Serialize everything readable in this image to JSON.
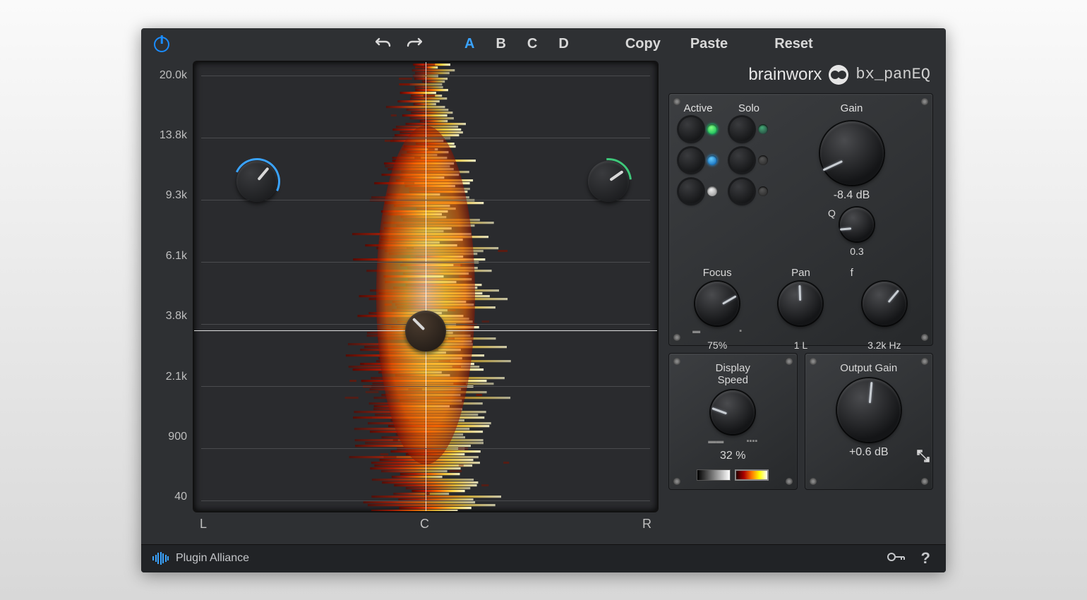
{
  "toolbar": {
    "snapshots": [
      "A",
      "B",
      "C",
      "D"
    ],
    "active_snapshot": "A",
    "copy": "Copy",
    "paste": "Paste",
    "reset": "Reset"
  },
  "brand": {
    "name": "brainworx",
    "product": "bx_panEQ"
  },
  "yaxis": [
    "20.0k",
    "13.8k",
    "9.3k",
    "6.1k",
    "3.8k",
    "2.1k",
    "900",
    "40"
  ],
  "xaxis": {
    "left": "L",
    "center": "C",
    "right": "R"
  },
  "bands": {
    "headers": {
      "active": "Active",
      "solo": "Solo",
      "gain": "Gain"
    },
    "gain": {
      "value": "-8.4 dB",
      "angle": -115
    },
    "q": {
      "label": "Q",
      "value": "0.3",
      "angle": -95
    },
    "focus": {
      "label": "Focus",
      "value": "75%",
      "angle": 60
    },
    "pan": {
      "label": "Pan",
      "value": "1 L",
      "angle": -2
    },
    "freq": {
      "label": "f",
      "value": "3.2k Hz",
      "angle": 40
    }
  },
  "display": {
    "label": "Display\nSpeed",
    "value": "32 %",
    "angle": -70
  },
  "output": {
    "label": "Output Gain",
    "value": "+0.6 dB",
    "angle": 5
  },
  "footer": {
    "text": "Plugin Alliance"
  }
}
